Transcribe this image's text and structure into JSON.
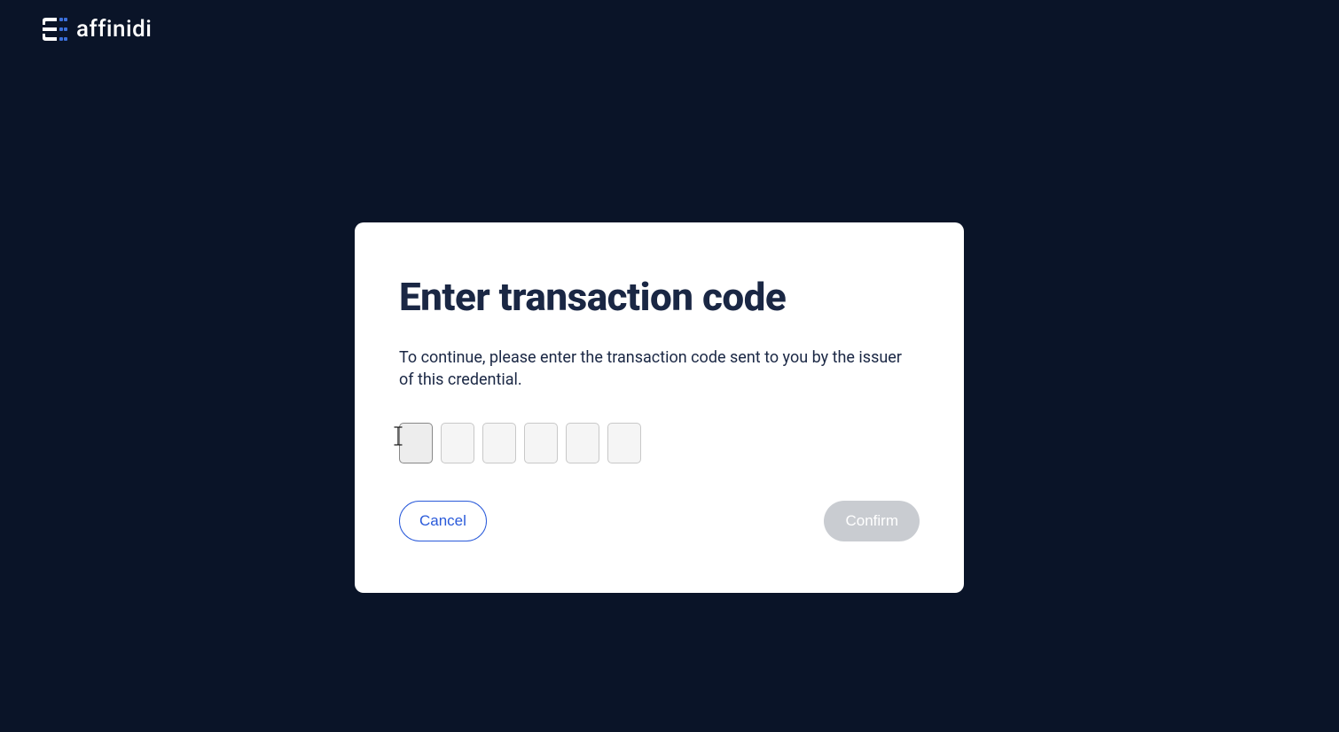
{
  "brand": {
    "name": "affinidi"
  },
  "modal": {
    "title": "Enter transaction code",
    "description": "To continue, please enter the transaction code sent to you by the issuer of this credential.",
    "code_digits": 6,
    "buttons": {
      "cancel": "Cancel",
      "confirm": "Confirm"
    }
  },
  "colors": {
    "background": "#0a1428",
    "modal_bg": "#ffffff",
    "title_text": "#1a2744",
    "accent": "#2a5ada",
    "disabled": "#c9ccd1"
  }
}
